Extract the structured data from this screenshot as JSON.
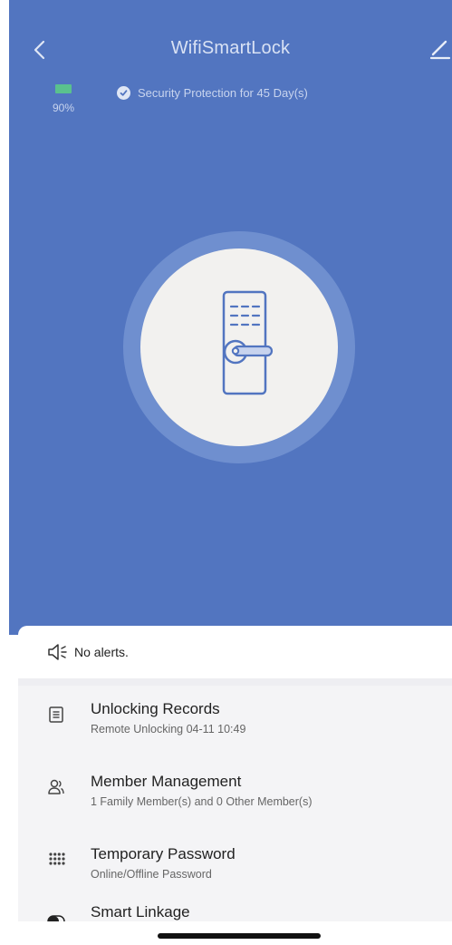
{
  "header": {
    "title": "WifiSmartLock",
    "back_icon": "chevron-left-icon",
    "edit_icon": "pencil-icon"
  },
  "status": {
    "battery_percent": "90%",
    "security_text": "Security Protection for 45 Day(s)"
  },
  "lock": {
    "icon": "door-lock-icon"
  },
  "alerts": {
    "text": "No alerts.",
    "icon": "speaker-icon"
  },
  "menu": {
    "items": [
      {
        "title": "Unlocking Records",
        "subtitle": "Remote Unlocking 04-11 10:49",
        "icon": "document-list-icon"
      },
      {
        "title": "Member Management",
        "subtitle": "1 Family Member(s) and 0 Other Member(s)",
        "icon": "members-icon"
      },
      {
        "title": "Temporary Password",
        "subtitle": "Online/Offline Password",
        "icon": "keypad-icon"
      },
      {
        "title": "Smart Linkage",
        "subtitle": "",
        "icon": "toggle-icon"
      }
    ]
  },
  "colors": {
    "hero_bg": "#5275c0",
    "battery_green": "#5ac18e"
  }
}
